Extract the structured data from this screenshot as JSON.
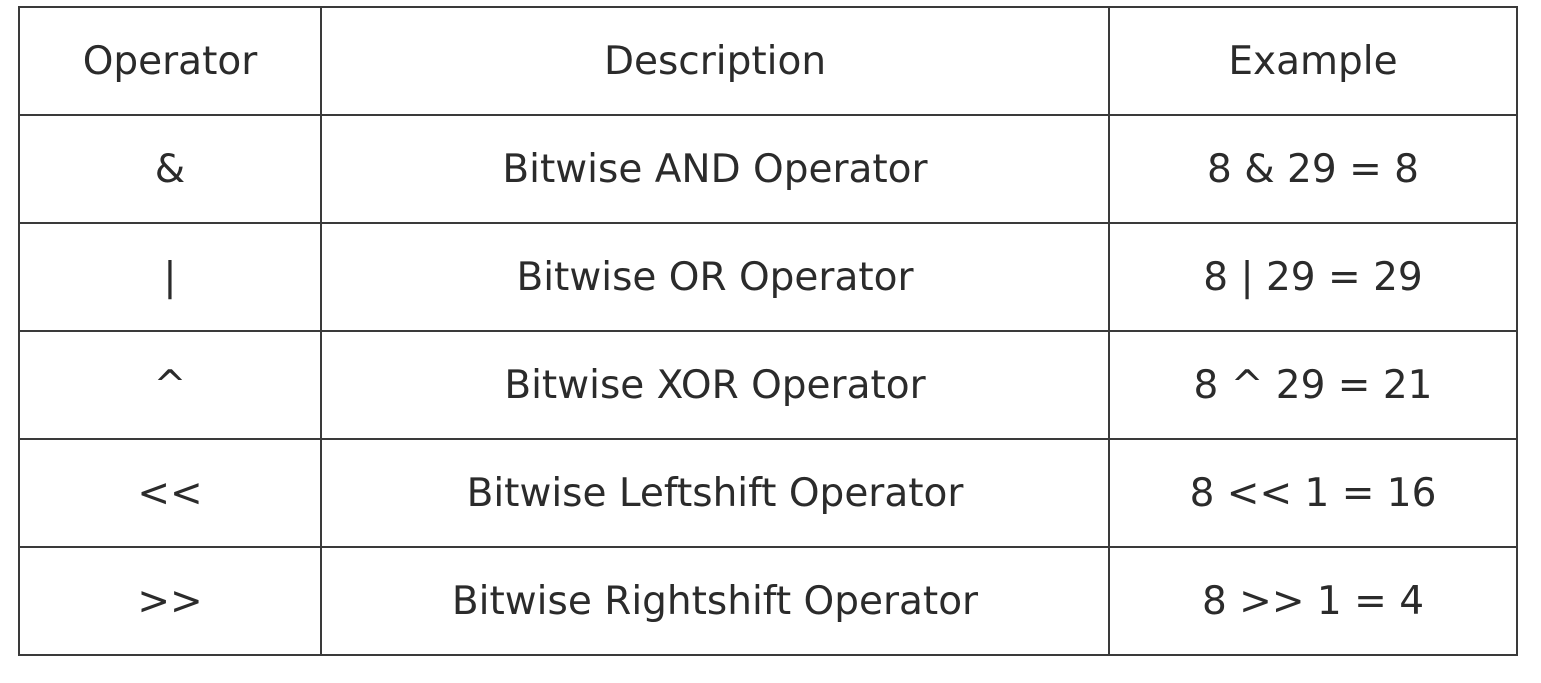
{
  "table": {
    "headers": [
      "Operator",
      "Description",
      "Example"
    ],
    "rows": [
      [
        "&",
        "Bitwise AND Operator",
        "8 & 29 = 8"
      ],
      [
        "|",
        "Bitwise OR Operator",
        "8 | 29 = 29"
      ],
      [
        "^",
        "Bitwise XOR Operator",
        "8 ^ 29 = 21"
      ],
      [
        "<<",
        "Bitwise Leftshift Operator",
        "8 << 1 = 16"
      ],
      [
        ">>",
        "Bitwise Rightshift Operator",
        "8 >> 1 = 4"
      ]
    ]
  }
}
